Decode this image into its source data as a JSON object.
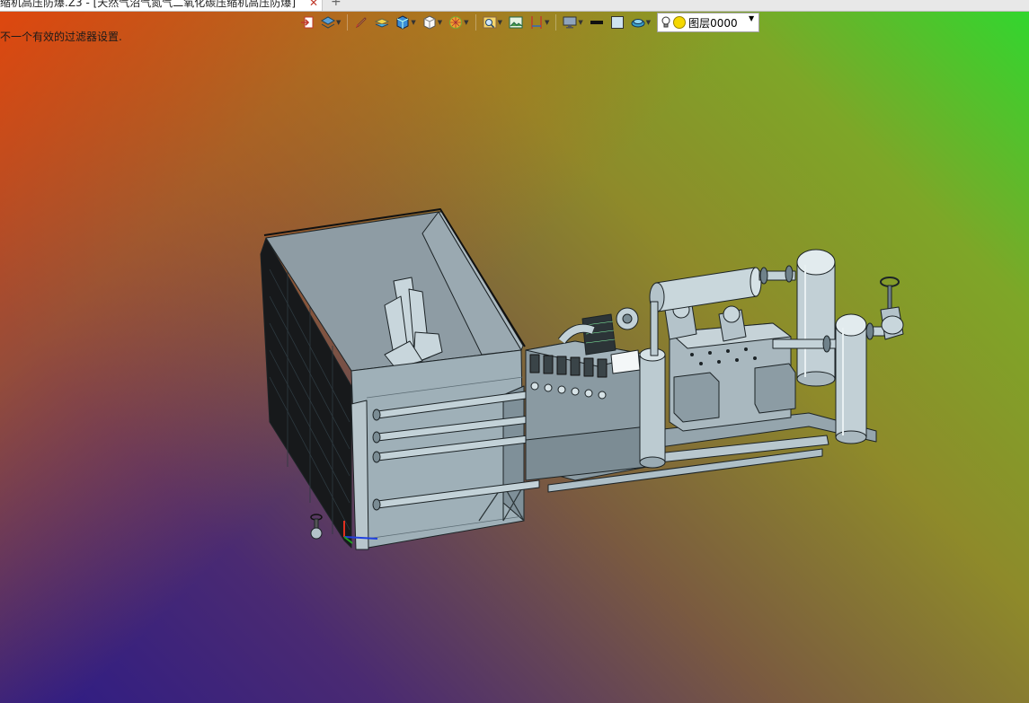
{
  "window": {
    "tab_title": "缩机高压防爆.Z3 - [天然气沼气氮气二氧化碳压缩机高压防爆]",
    "close_symbol": "✕",
    "new_tab_symbol": "+"
  },
  "status": {
    "message": "不一个有效的过滤器设置."
  },
  "toolbar": {
    "buttons": [
      {
        "icon": "exit-icon",
        "has_menu": false
      },
      {
        "icon": "view-icon",
        "has_menu": true
      },
      {
        "icon": "pen-icon",
        "has_menu": false
      },
      {
        "icon": "layers-icon",
        "has_menu": false
      },
      {
        "icon": "cube-blue-icon",
        "has_menu": true
      },
      {
        "icon": "cube-white-icon",
        "has_menu": true
      },
      {
        "icon": "render-icon",
        "has_menu": true
      },
      {
        "icon": "zoom-icon",
        "has_menu": true
      },
      {
        "icon": "image-icon",
        "has_menu": false
      },
      {
        "icon": "dimension-icon",
        "has_menu": true
      },
      {
        "icon": "display-icon",
        "has_menu": true
      },
      {
        "icon": "line-icon",
        "has_menu": false
      },
      {
        "icon": "color-icon",
        "has_menu": false
      },
      {
        "icon": "plane-icon",
        "has_menu": true
      }
    ],
    "layer_name": "图层0000"
  },
  "colors": {
    "accent_yellow": "#f5d800",
    "model_fill": "#a8b7bf",
    "model_stroke": "#1c2326"
  }
}
